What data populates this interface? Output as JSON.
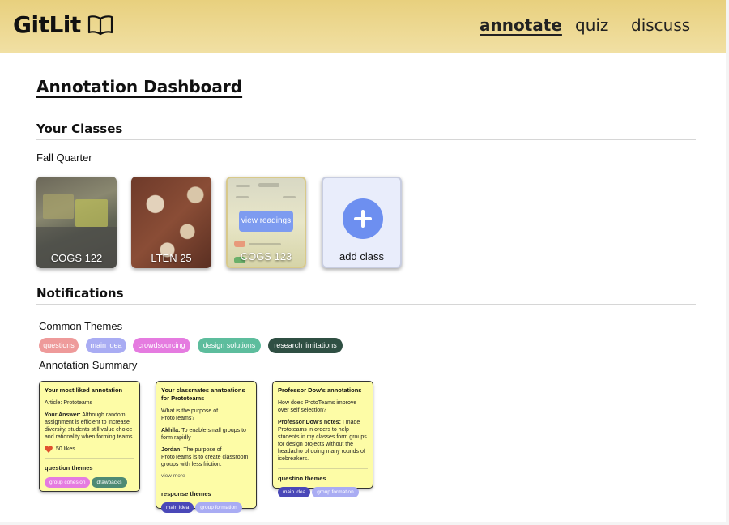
{
  "header": {
    "app_name": "GitLit",
    "logo_icon": "book-icon",
    "nav": [
      {
        "label": "annotate",
        "active": true
      },
      {
        "label": "quiz",
        "active": false
      },
      {
        "label": "discuss",
        "active": false
      }
    ],
    "background": "#ecd690"
  },
  "dashboard": {
    "title": "Annotation Dashboard"
  },
  "classes": {
    "heading": "Your Classes",
    "quarter": "Fall Quarter",
    "items": [
      {
        "label": "COGS 122"
      },
      {
        "label": "LTEN 25"
      },
      {
        "label": "COGS 123",
        "hover_action": "view readings"
      }
    ],
    "add": {
      "label": "add class",
      "icon": "plus-icon",
      "accent": "#6d8ff0"
    }
  },
  "notifications": {
    "heading": "Notifications",
    "common_themes_label": "Common Themes",
    "themes": [
      {
        "label": "questions",
        "color": "#ee9a9a"
      },
      {
        "label": "main idea",
        "color": "#a9acf3"
      },
      {
        "label": "crowdsourcing",
        "color": "#e57be0"
      },
      {
        "label": "design solutions",
        "color": "#5dbd9d"
      },
      {
        "label": "research limitations",
        "color": "#2f4f43"
      }
    ],
    "summary_label": "Annotation Summary"
  },
  "summary_cards": [
    {
      "title": "Your most liked annotation",
      "article": "Article: Prototeams",
      "answer_label": "Your Answer:",
      "answer": " Although random assignment is efficient to increase diversity, students still value choice and rationality when forming teams",
      "likes": "50 likes",
      "themes_heading": "question themes",
      "tags": [
        {
          "label": "group cohesion",
          "color": "#e57be0"
        },
        {
          "label": "drawbacks",
          "color": "#4e8a74"
        }
      ]
    },
    {
      "title": "Your classmates anntoations for Prototeams",
      "question": "What is the purpose of ProtoTeams?",
      "responses": [
        {
          "name": "Akhila:",
          "text": " To enable small groups to form rapidly"
        },
        {
          "name": "Jordan:",
          "text": " The purpose of ProtoTeams is to create classroom groups with less friction."
        }
      ],
      "view_more": "view more",
      "themes_heading": "response themes",
      "tags": [
        {
          "label": "main idea",
          "color": "#4a48b8"
        },
        {
          "label": "group formation",
          "color": "#a9acf3"
        }
      ]
    },
    {
      "title": "Professor Dow's annotations",
      "question": "How does ProtoTeams improve over self selection?",
      "notes_label": "Professor Dow's notes:",
      "notes": " I made Prototeams in orders to help students in my classes form groups for design projects without the headacho of doing many rounds of icebreakers.",
      "themes_heading": "question themes",
      "tags": [
        {
          "label": "main idea",
          "color": "#4a48b8"
        },
        {
          "label": "group formation",
          "color": "#a9acf3"
        }
      ]
    }
  ]
}
